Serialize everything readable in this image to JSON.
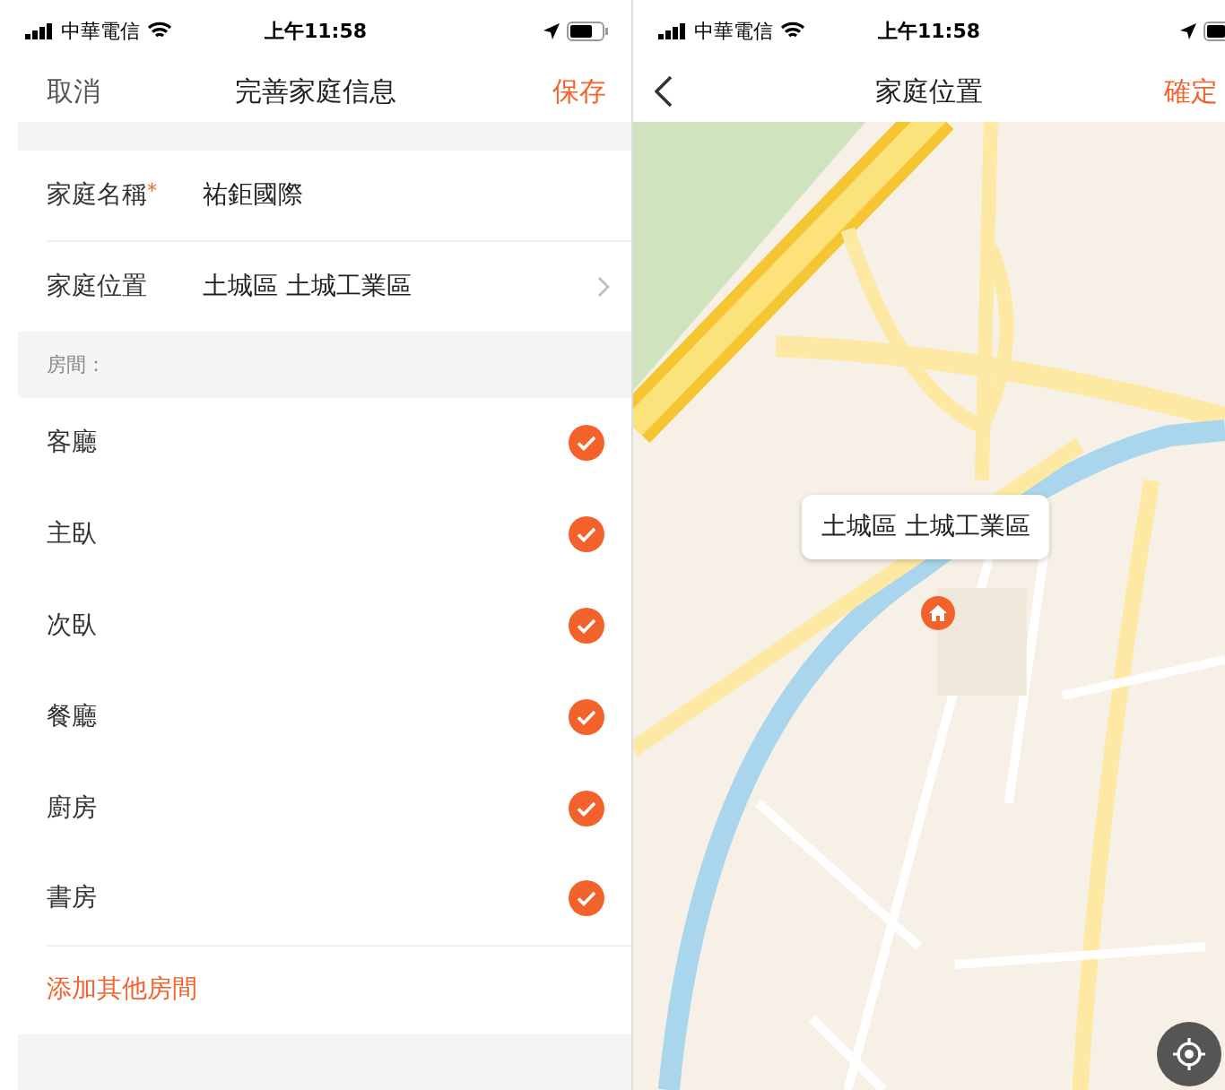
{
  "left_screen": {
    "status_bar": {
      "carrier": "中華電信",
      "time": "上午11:58"
    },
    "nav": {
      "cancel": "取消",
      "title": "完善家庭信息",
      "save": "保存"
    },
    "fields": [
      {
        "label": "家庭名稱",
        "required_mark": "*",
        "value": "祐鉅國際",
        "chevron": false
      },
      {
        "label": "家庭位置",
        "value": "土城區 土城工業區",
        "chevron": true
      }
    ],
    "rooms_header": "房間：",
    "rooms": [
      {
        "name": "客廳",
        "checked": true
      },
      {
        "name": "主臥",
        "checked": true
      },
      {
        "name": "次臥",
        "checked": true
      },
      {
        "name": "餐廳",
        "checked": true
      },
      {
        "name": "廚房",
        "checked": true
      },
      {
        "name": "書房",
        "checked": true
      }
    ],
    "add_room": "添加其他房間"
  },
  "right_screen": {
    "status_bar": {
      "carrier": "中華電信",
      "time": "上午11:58"
    },
    "nav": {
      "title": "家庭位置",
      "confirm": "確定"
    },
    "map": {
      "callout": "土城區 土城工業區"
    }
  }
}
